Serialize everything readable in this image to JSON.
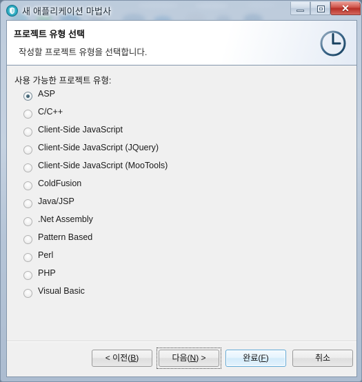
{
  "window": {
    "title": "새 애플리케이션 마법사",
    "app_icon": "shield-circle-icon",
    "controls": {
      "minimize": "minimize-icon",
      "maximize": "restore-icon",
      "close": "✕"
    }
  },
  "header": {
    "title": "프로젝트 유형 선택",
    "description": "작성할 프로젝트 유형을 선택합니다.",
    "logo": "clock-circle-logo"
  },
  "content": {
    "list_label": "사용 가능한 프로젝트 유형:",
    "selected": "ASP",
    "options": [
      {
        "label": "ASP",
        "checked": true
      },
      {
        "label": "C/C++",
        "checked": false
      },
      {
        "label": "Client-Side JavaScript",
        "checked": false
      },
      {
        "label": "Client-Side JavaScript (JQuery)",
        "checked": false
      },
      {
        "label": "Client-Side JavaScript (MooTools)",
        "checked": false
      },
      {
        "label": "ColdFusion",
        "checked": false
      },
      {
        "label": "Java/JSP",
        "checked": false
      },
      {
        "label": ".Net Assembly",
        "checked": false
      },
      {
        "label": "Pattern Based",
        "checked": false
      },
      {
        "label": "Perl",
        "checked": false
      },
      {
        "label": "PHP",
        "checked": false
      },
      {
        "label": "Visual Basic",
        "checked": false
      }
    ]
  },
  "buttons": {
    "back": "< 이전(B)",
    "next": "다음(N) >",
    "finish": "완료(F)",
    "cancel": "취소",
    "focused": "다음(N) >",
    "default": "완료(F)"
  },
  "colors": {
    "accent": "#2d4f61",
    "default_button_border": "#5fa8d6",
    "close_button": "#b73027",
    "client_background": "#f0f0f0",
    "header_background": "#ffffff"
  }
}
